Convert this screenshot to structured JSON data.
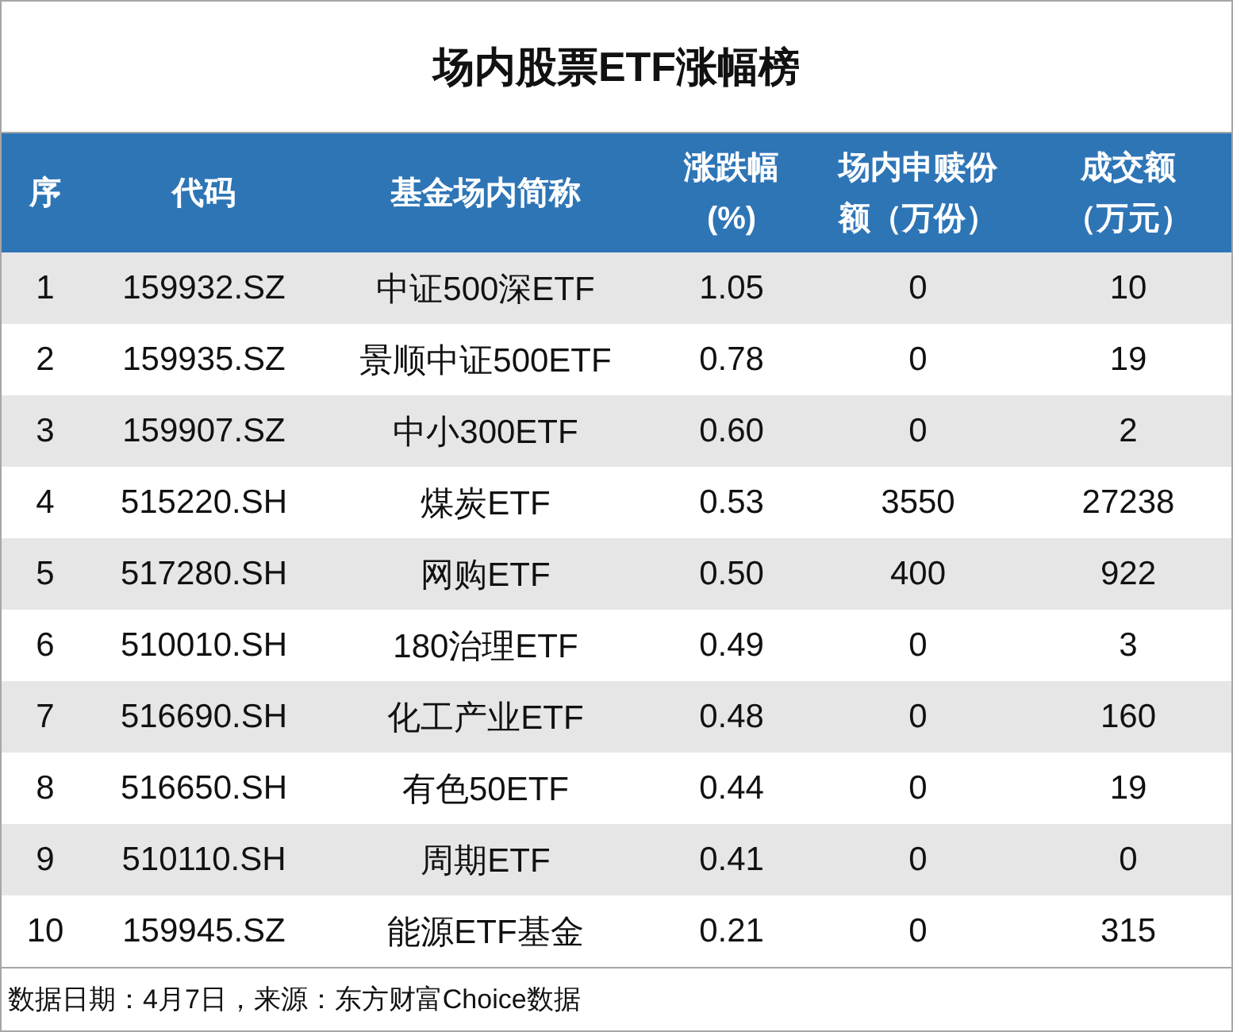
{
  "title": "场内股票ETF涨幅榜",
  "columns": [
    [
      "序"
    ],
    [
      "代码"
    ],
    [
      "基金场内简称"
    ],
    [
      "涨跌幅",
      "(%)"
    ],
    [
      "场内申赎份",
      "额（万份）"
    ],
    [
      "成交额",
      "（万元）"
    ]
  ],
  "rows": [
    [
      "1",
      "159932.SZ",
      "中证500深ETF",
      "1.05",
      "0",
      "10"
    ],
    [
      "2",
      "159935.SZ",
      "景顺中证500ETF",
      "0.78",
      "0",
      "19"
    ],
    [
      "3",
      "159907.SZ",
      "中小300ETF",
      "0.60",
      "0",
      "2"
    ],
    [
      "4",
      "515220.SH",
      "煤炭ETF",
      "0.53",
      "3550",
      "27238"
    ],
    [
      "5",
      "517280.SH",
      "网购ETF",
      "0.50",
      "400",
      "922"
    ],
    [
      "6",
      "510010.SH",
      "180治理ETF",
      "0.49",
      "0",
      "3"
    ],
    [
      "7",
      "516690.SH",
      "化工产业ETF",
      "0.48",
      "0",
      "160"
    ],
    [
      "8",
      "516650.SH",
      "有色50ETF",
      "0.44",
      "0",
      "19"
    ],
    [
      "9",
      "510110.SH",
      "周期ETF",
      "0.41",
      "0",
      "0"
    ],
    [
      "10",
      "159945.SZ",
      "能源ETF基金",
      "0.21",
      "0",
      "315"
    ]
  ],
  "footnote": "数据日期：4月7日，来源：东方财富Choice数据"
}
